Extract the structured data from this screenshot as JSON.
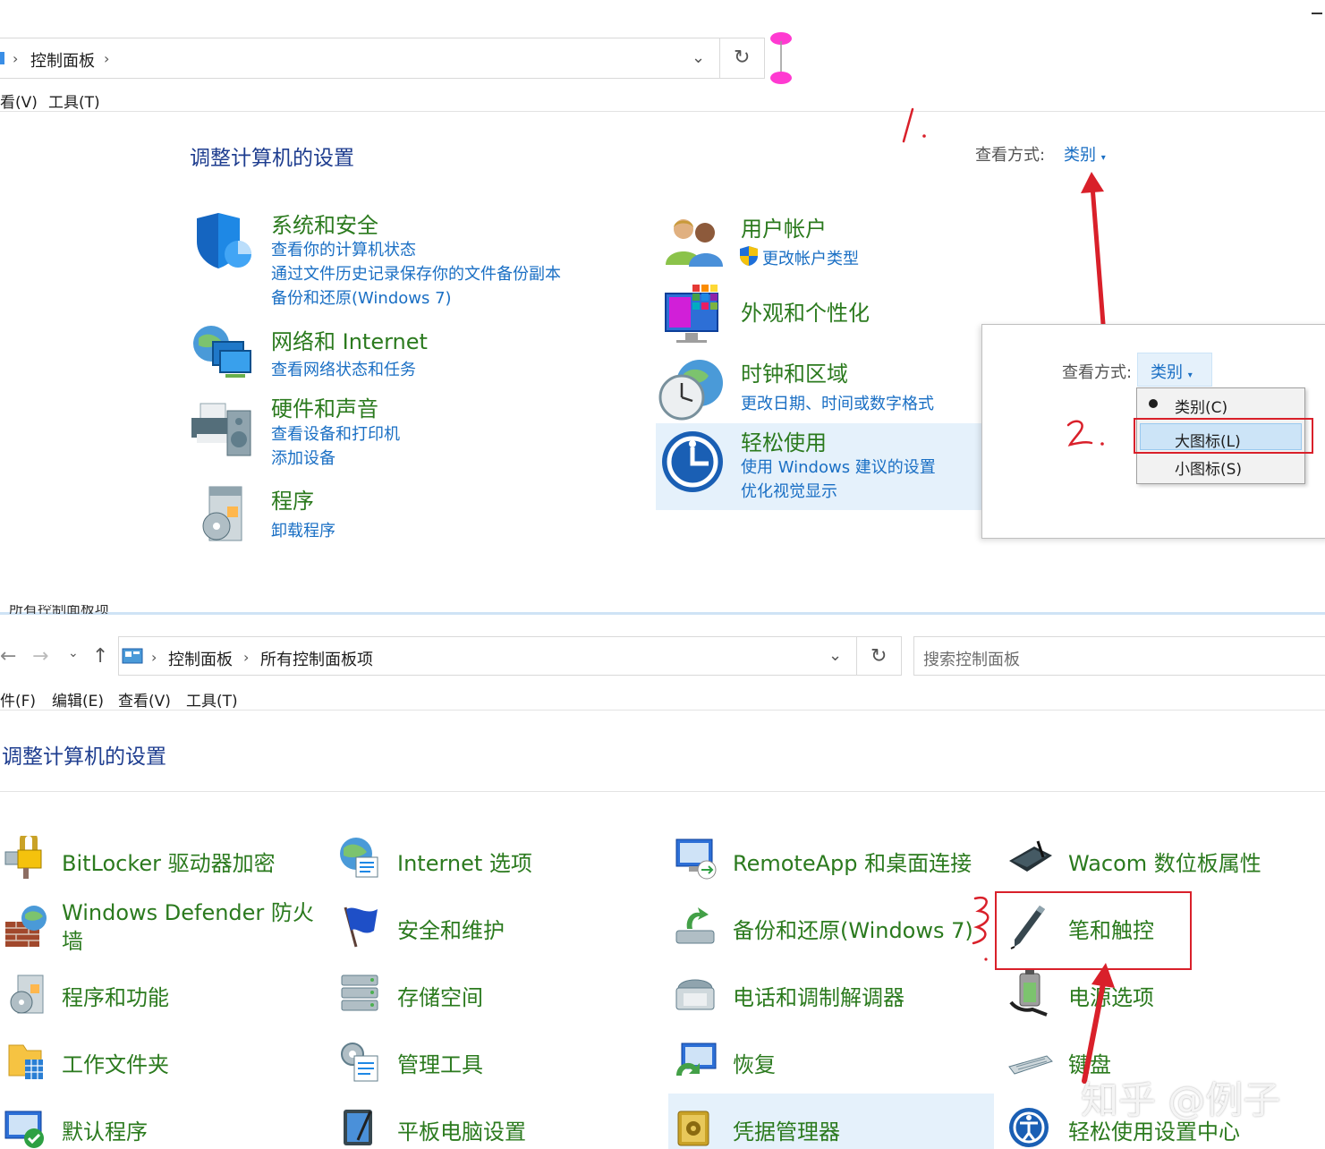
{
  "top": {
    "breadcrumb": "控制面板",
    "menu": [
      "看(V)",
      "工具(T)"
    ],
    "heading": "调整计算机的设置",
    "view_by_label": "查看方式:",
    "view_by_value": "类别",
    "categories": [
      {
        "title": "系统和安全",
        "links": [
          "查看你的计算机状态",
          "通过文件历史记录保存你的文件备份副本",
          "备份和还原(Windows 7)"
        ]
      },
      {
        "title": "网络和 Internet",
        "links": [
          "查看网络状态和任务"
        ]
      },
      {
        "title": "硬件和声音",
        "links": [
          "查看设备和打印机",
          "添加设备"
        ]
      },
      {
        "title": "程序",
        "links": [
          "卸载程序"
        ]
      },
      {
        "title": "用户帐户",
        "links": [
          "更改帐户类型"
        ]
      },
      {
        "title": "外观和个性化",
        "links": []
      },
      {
        "title": "时钟和区域",
        "links": [
          "更改日期、时间或数字格式"
        ]
      },
      {
        "title": "轻松使用",
        "links": [
          "使用 Windows 建议的设置",
          "优化视觉显示"
        ]
      }
    ]
  },
  "popup": {
    "view_by_label": "查看方式:",
    "view_by_value": "类别",
    "options": [
      "类别(C)",
      "大图标(L)",
      "小图标(S)"
    ],
    "selected_option": "大图标(L)",
    "checked_option": "类别(C)"
  },
  "annotations": {
    "step1": "1.",
    "step2": "2."
  },
  "bottom": {
    "title_partial": "所有控制面板项",
    "breadcrumb": [
      "控制面板",
      "所有控制面板项"
    ],
    "search_placeholder": "搜索控制面板",
    "menu": [
      "件(F)",
      "编辑(E)",
      "查看(V)",
      "工具(T)"
    ],
    "heading": "调整计算机的设置",
    "items": [
      [
        "BitLocker 驱动器加密",
        "Internet 选项",
        "RemoteApp 和桌面连接",
        "Wacom 数位板属性"
      ],
      [
        "Windows Defender 防火墙",
        "安全和维护",
        "备份和还原(Windows 7)",
        "笔和触控"
      ],
      [
        "程序和功能",
        "存储空间",
        "电话和调制解调器",
        "电源选项"
      ],
      [
        "工作文件夹",
        "管理工具",
        "恢复",
        "键盘"
      ],
      [
        "默认程序",
        "平板电脑设置",
        "凭据管理器",
        "轻松使用设置中心"
      ]
    ]
  },
  "watermark": "知乎 @例子",
  "colors": {
    "link": "#1a6fc4",
    "category": "#2b7a1e",
    "heading": "#1e3d8f",
    "annotation": "#d9202a",
    "highlight": "#e5f1fb"
  }
}
